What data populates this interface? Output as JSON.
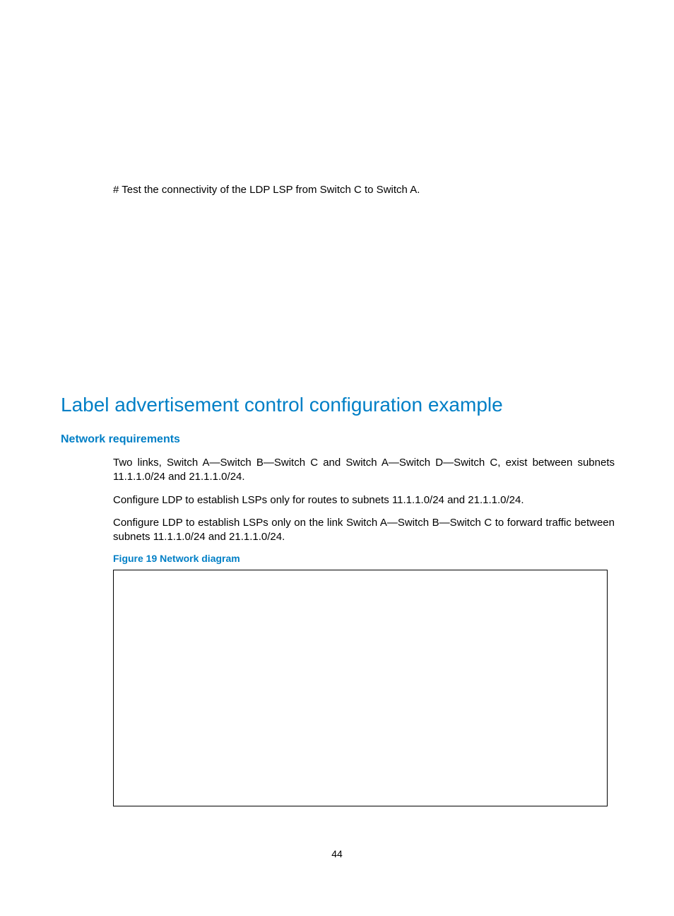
{
  "intro": "# Test the connectivity of the LDP LSP from Switch C to Switch A.",
  "section": {
    "heading": "Label advertisement control configuration example",
    "subsection": {
      "heading": "Network requirements",
      "paragraphs": [
        "Two links, Switch A—Switch B—Switch C and Switch A—Switch D—Switch C, exist between subnets 11.1.1.0/24 and 21.1.1.0/24.",
        "Configure LDP to establish LSPs only for routes to subnets 11.1.1.0/24 and 21.1.1.0/24.",
        "Configure LDP to establish LSPs only on the link Switch A—Switch B—Switch C to forward traffic between subnets 11.1.1.0/24 and 21.1.1.0/24."
      ],
      "figure_caption": "Figure 19 Network diagram"
    }
  },
  "page_number": "44"
}
